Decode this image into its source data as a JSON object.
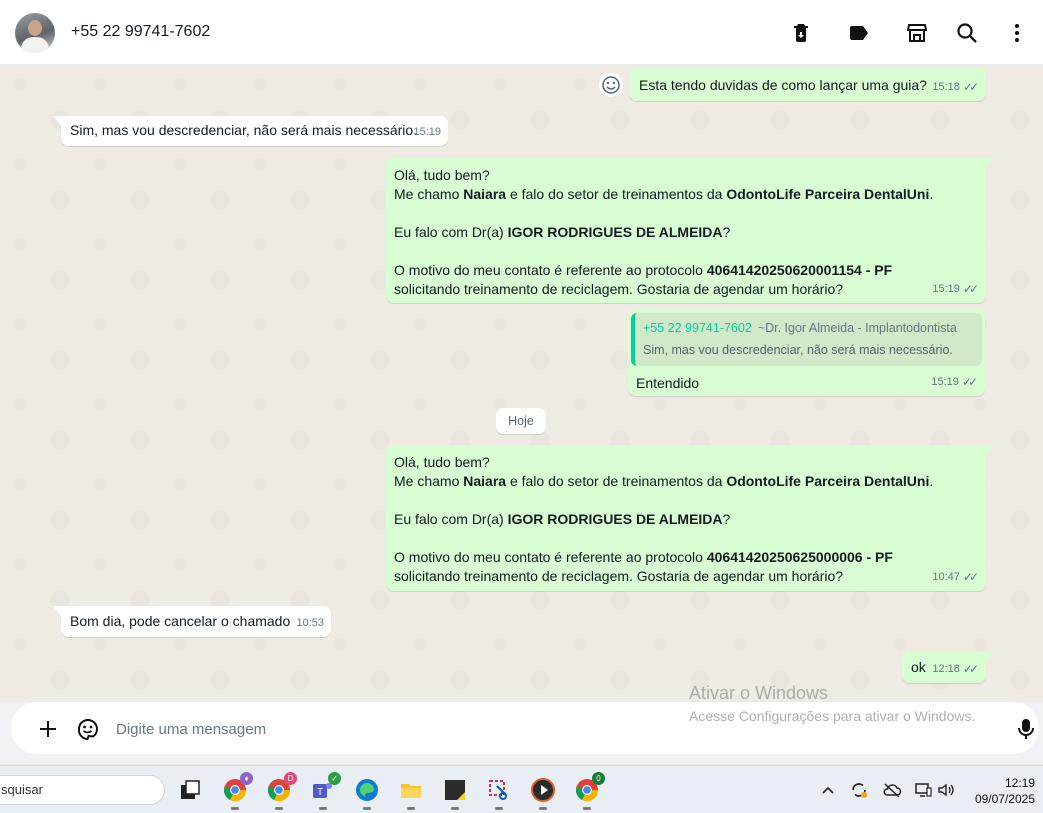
{
  "header": {
    "contact_name": "+55 22 99741-7602",
    "icons": [
      "delete-icon",
      "label-icon",
      "catalog-icon",
      "search-icon",
      "more-options-icon"
    ]
  },
  "messages": [
    {
      "dir": "out",
      "text": "Esta tendo duvidas de como lançar uma guia?",
      "time": "15:18",
      "status": "read"
    },
    {
      "dir": "in",
      "text": "Sim, mas vou descredenciar, não será mais necessário.",
      "time": "15:19"
    },
    {
      "dir": "out",
      "time": "15:19",
      "status": "read",
      "lines": {
        "l1": "Olá, tudo bem?",
        "l2a": "Me chamo ",
        "l2b": "Naiara",
        "l2c": " e falo do setor de treinamentos da ",
        "l2d": "OdontoLife Parceira DentalUni",
        "l2e": ".",
        "l3a": "Eu falo com Dr(a) ",
        "l3b": "IGOR RODRIGUES DE ALMEIDA",
        "l3c": "?",
        "l4a": "O motivo do meu contato é referente ao protocolo ",
        "l4b": "40641420250620001154  - PF",
        "l5": "solicitando treinamento de reciclagem. Gostaria de agendar um horário?"
      }
    },
    {
      "dir": "out",
      "time": "15:19",
      "status": "read",
      "quote": {
        "author": "+55 22 99741-7602",
        "alias": "~Dr. Igor Almeida - Implantodontista",
        "text": "Sim, mas vou descredenciar, não será mais necessário."
      },
      "text": "Entendido"
    },
    {
      "dir": "out",
      "time": "10:47",
      "status": "read",
      "lines": {
        "l1": "Olá, tudo bem?",
        "l2a": "Me chamo ",
        "l2b": "Naiara",
        "l2c": " e falo do setor de treinamentos da ",
        "l2d": "OdontoLife Parceira DentalUni",
        "l2e": ".",
        "l3a": "Eu falo com Dr(a) ",
        "l3b": "IGOR RODRIGUES DE ALMEIDA",
        "l3c": "?",
        "l4a": "O motivo do meu contato é referente ao protocolo ",
        "l4b": "40641420250625000006  - PF",
        "l5": "solicitando treinamento de reciclagem. Gostaria de agendar um horário?"
      }
    },
    {
      "dir": "in",
      "text": "Bom dia, pode cancelar o chamado",
      "time": "10:53"
    },
    {
      "dir": "out",
      "text": "ok",
      "time": "12:18",
      "status": "read"
    }
  ],
  "date_separator": "Hoje",
  "ticks_glyph": "✓✓",
  "composer": {
    "placeholder": "Digite uma mensagem"
  },
  "watermark": {
    "title": "Ativar o Windows",
    "subtitle": "Acesse Configurações para ativar o Windows."
  },
  "taskbar": {
    "search_text": "squisar",
    "time": "12:19",
    "date": "09/07/2025",
    "badges": {
      "chrome2": "D",
      "chrome3": "0"
    }
  },
  "colors": {
    "outgoing": "#d9fdd3",
    "incoming": "#ffffff",
    "accent": "#06cf9c",
    "chat_bg": "#efeae2"
  }
}
